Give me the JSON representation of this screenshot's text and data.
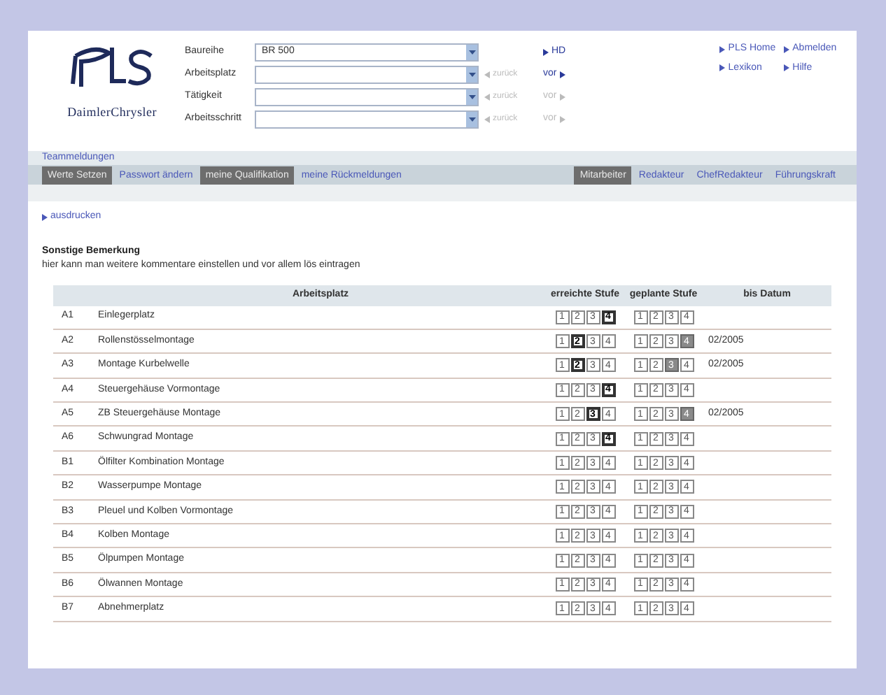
{
  "logo": {
    "brand": "DaimlerChrysler"
  },
  "filters": [
    {
      "label": "Baureihe",
      "value": "BR 500",
      "forward": {
        "text": "HD",
        "disabled": false
      }
    },
    {
      "label": "Arbeitsplatz",
      "back": {
        "text": "zurück",
        "disabled": true
      },
      "forward": {
        "text": "vor",
        "disabled": false
      }
    },
    {
      "label": "Tätigkeit",
      "back": {
        "text": "zurück",
        "disabled": true
      },
      "forward": {
        "text": "vor",
        "disabled": true
      }
    },
    {
      "label": "Arbeitsschritt",
      "back": {
        "text": "zurück",
        "disabled": true
      },
      "forward": {
        "text": "vor",
        "disabled": true
      }
    }
  ],
  "top_links": [
    "PLS Home",
    "Abmelden",
    "Lexikon",
    "Hilfe"
  ],
  "section_link": "Teammeldungen",
  "tabs_left": [
    {
      "label": "Werte Setzen",
      "selected": true
    },
    {
      "label": "Passwort ändern",
      "selected": false
    },
    {
      "label": "meine Qualifikation",
      "selected": true
    },
    {
      "label": "meine Rückmeldungen",
      "selected": false
    }
  ],
  "tabs_right": [
    {
      "label": "Mitarbeiter",
      "selected": true
    },
    {
      "label": "Redakteur",
      "selected": false
    },
    {
      "label": "ChefRedakteur",
      "selected": false
    },
    {
      "label": "Führungskraft",
      "selected": false
    }
  ],
  "print_link": "ausdrucken",
  "remark": {
    "title": "Sonstige Bemerkung",
    "text": "hier kann man weitere kommentare einstellen und vor allem lös eintragen"
  },
  "table": {
    "columns": [
      "Arbeitsplatz",
      "erreichte Stufe",
      "geplante Stufe",
      "bis Datum"
    ],
    "rows": [
      {
        "code": "A1",
        "name": "Einlegerplatz",
        "reached": [
          {
            "label": "1",
            "selected": false
          },
          {
            "label": "2",
            "selected": false
          },
          {
            "label": "3",
            "selected": false
          },
          {
            "label": "4",
            "selected": true
          }
        ],
        "planned": [
          {
            "label": "1",
            "selected": false
          },
          {
            "label": "2",
            "selected": false
          },
          {
            "label": "3",
            "selected": false
          },
          {
            "label": "4",
            "selected": false
          }
        ]
      },
      {
        "code": "A2",
        "name": "Rollenstösselmontage",
        "reached": [
          {
            "label": "1",
            "selected": false
          },
          {
            "label": "2",
            "selected": true
          },
          {
            "label": "3",
            "selected": false
          },
          {
            "label": "4",
            "selected": false
          }
        ],
        "planned": [
          {
            "label": "1",
            "selected": false
          },
          {
            "label": "2",
            "selected": false
          },
          {
            "label": "3",
            "selected": false
          },
          {
            "label": "4",
            "selected": true
          }
        ],
        "date": "02/2005"
      },
      {
        "code": "A3",
        "name": "Montage Kurbelwelle",
        "reached": [
          {
            "label": "1",
            "selected": false
          },
          {
            "label": "2",
            "selected": true
          },
          {
            "label": "3",
            "selected": false
          },
          {
            "label": "4",
            "selected": false
          }
        ],
        "planned": [
          {
            "label": "1",
            "selected": false
          },
          {
            "label": "2",
            "selected": false
          },
          {
            "label": "3",
            "selected": true
          },
          {
            "label": "4",
            "selected": false
          }
        ],
        "date": "02/2005"
      },
      {
        "code": "A4",
        "name": "Steuergehäuse Vormontage",
        "reached": [
          {
            "label": "1",
            "selected": false
          },
          {
            "label": "2",
            "selected": false
          },
          {
            "label": "3",
            "selected": false
          },
          {
            "label": "4",
            "selected": true
          }
        ],
        "planned": [
          {
            "label": "1",
            "selected": false
          },
          {
            "label": "2",
            "selected": false
          },
          {
            "label": "3",
            "selected": false
          },
          {
            "label": "4",
            "selected": false
          }
        ]
      },
      {
        "code": "A5",
        "name": "ZB Steuergehäuse Montage",
        "reached": [
          {
            "label": "1",
            "selected": false
          },
          {
            "label": "2",
            "selected": false
          },
          {
            "label": "3",
            "selected": true
          },
          {
            "label": "4",
            "selected": false
          }
        ],
        "planned": [
          {
            "label": "1",
            "selected": false
          },
          {
            "label": "2",
            "selected": false
          },
          {
            "label": "3",
            "selected": false
          },
          {
            "label": "4",
            "selected": true
          }
        ],
        "date": "02/2005"
      },
      {
        "code": "A6",
        "name": "Schwungrad Montage",
        "reached": [
          {
            "label": "1",
            "selected": false
          },
          {
            "label": "2",
            "selected": false
          },
          {
            "label": "3",
            "selected": false
          },
          {
            "label": "4",
            "selected": true
          }
        ],
        "planned": [
          {
            "label": "1",
            "selected": false
          },
          {
            "label": "2",
            "selected": false
          },
          {
            "label": "3",
            "selected": false
          },
          {
            "label": "4",
            "selected": false
          }
        ]
      },
      {
        "code": "B1",
        "name": "Ölfilter Kombination Montage",
        "reached": [
          {
            "label": "1",
            "selected": false
          },
          {
            "label": "2",
            "selected": false
          },
          {
            "label": "3",
            "selected": false
          },
          {
            "label": "4",
            "selected": false
          }
        ],
        "planned": [
          {
            "label": "1",
            "selected": false
          },
          {
            "label": "2",
            "selected": false
          },
          {
            "label": "3",
            "selected": false
          },
          {
            "label": "4",
            "selected": false
          }
        ]
      },
      {
        "code": "B2",
        "name": "Wasserpumpe Montage",
        "reached": [
          {
            "label": "1",
            "selected": false
          },
          {
            "label": "2",
            "selected": false
          },
          {
            "label": "3",
            "selected": false
          },
          {
            "label": "4",
            "selected": false
          }
        ],
        "planned": [
          {
            "label": "1",
            "selected": false
          },
          {
            "label": "2",
            "selected": false
          },
          {
            "label": "3",
            "selected": false
          },
          {
            "label": "4",
            "selected": false
          }
        ]
      },
      {
        "code": "B3",
        "name": "Pleuel und Kolben Vormontage",
        "reached": [
          {
            "label": "1",
            "selected": false
          },
          {
            "label": "2",
            "selected": false
          },
          {
            "label": "3",
            "selected": false
          },
          {
            "label": "4",
            "selected": false
          }
        ],
        "planned": [
          {
            "label": "1",
            "selected": false
          },
          {
            "label": "2",
            "selected": false
          },
          {
            "label": "3",
            "selected": false
          },
          {
            "label": "4",
            "selected": false
          }
        ]
      },
      {
        "code": "B4",
        "name": "Kolben Montage",
        "reached": [
          {
            "label": "1",
            "selected": false
          },
          {
            "label": "2",
            "selected": false
          },
          {
            "label": "3",
            "selected": false
          },
          {
            "label": "4",
            "selected": false
          }
        ],
        "planned": [
          {
            "label": "1",
            "selected": false
          },
          {
            "label": "2",
            "selected": false
          },
          {
            "label": "3",
            "selected": false
          },
          {
            "label": "4",
            "selected": false
          }
        ]
      },
      {
        "code": "B5",
        "name": "Ölpumpen Montage",
        "reached": [
          {
            "label": "1",
            "selected": false
          },
          {
            "label": "2",
            "selected": false
          },
          {
            "label": "3",
            "selected": false
          },
          {
            "label": "4",
            "selected": false
          }
        ],
        "planned": [
          {
            "label": "1",
            "selected": false
          },
          {
            "label": "2",
            "selected": false
          },
          {
            "label": "3",
            "selected": false
          },
          {
            "label": "4",
            "selected": false
          }
        ]
      },
      {
        "code": "B6",
        "name": "Ölwannen Montage",
        "reached": [
          {
            "label": "1",
            "selected": false
          },
          {
            "label": "2",
            "selected": false
          },
          {
            "label": "3",
            "selected": false
          },
          {
            "label": "4",
            "selected": false
          }
        ],
        "planned": [
          {
            "label": "1",
            "selected": false
          },
          {
            "label": "2",
            "selected": false
          },
          {
            "label": "3",
            "selected": false
          },
          {
            "label": "4",
            "selected": false
          }
        ]
      },
      {
        "code": "B7",
        "name": "Abnehmerplatz",
        "reached": [
          {
            "label": "1",
            "selected": false
          },
          {
            "label": "2",
            "selected": false
          },
          {
            "label": "3",
            "selected": false
          },
          {
            "label": "4",
            "selected": false
          }
        ],
        "planned": [
          {
            "label": "1",
            "selected": false
          },
          {
            "label": "2",
            "selected": false
          },
          {
            "label": "3",
            "selected": false
          },
          {
            "label": "4",
            "selected": false
          }
        ]
      }
    ]
  }
}
